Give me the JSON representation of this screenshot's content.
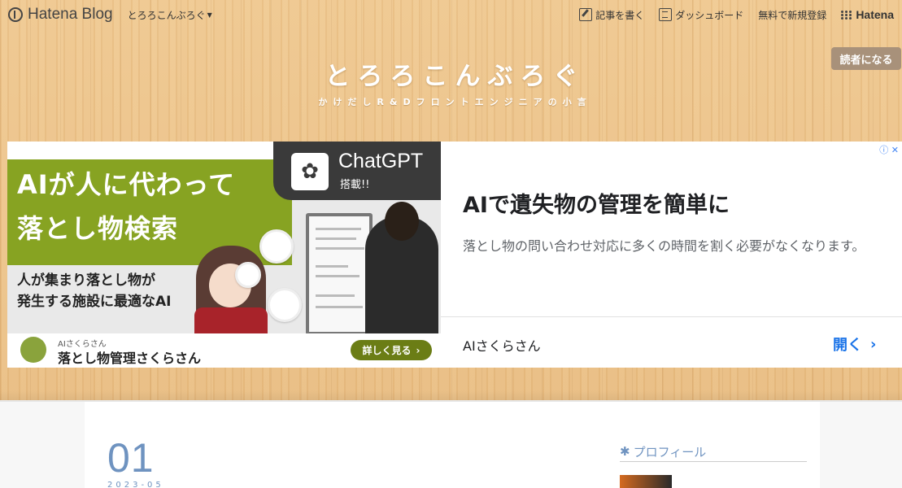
{
  "topbar": {
    "brand": "Hatena Blog",
    "blog_switch": "とろろこんぶろぐ",
    "nav": {
      "write": "記事を書く",
      "dashboard": "ダッシュボード",
      "register": "無料で新規登録",
      "hatena": "Hatena"
    }
  },
  "header": {
    "title": "とろろこんぶろぐ",
    "description": "かけだしR&Dフロントエンジニアの小言",
    "subscribe": "読者になる"
  },
  "ad": {
    "image": {
      "headline_line1": "AIが人に代わって",
      "headline_line2": "落とし物検索",
      "sub_line1": "人が集まり落とし物が",
      "sub_line2": "発生する施設に最適なAI",
      "gpt_name": "ChatGPT",
      "gpt_tag": "搭載!!",
      "footer_small": "AIさくらさん",
      "footer_name": "落とし物管理さくらさん",
      "footer_button": "詳しく見る"
    },
    "headline": "AIで遺失物の管理を簡単に",
    "body": "落とし物の問い合わせ対応に多くの時間を割く必要がなくなります。",
    "advertiser": "AIさくらさん",
    "cta": "開く"
  },
  "post": {
    "day": "01",
    "year_month": "2023-05"
  },
  "sidebar": {
    "profile_heading": "プロフィール"
  },
  "colors": {
    "accent": "#6f93c0",
    "ad_green": "#87a322",
    "cta_blue": "#1a73e8"
  }
}
